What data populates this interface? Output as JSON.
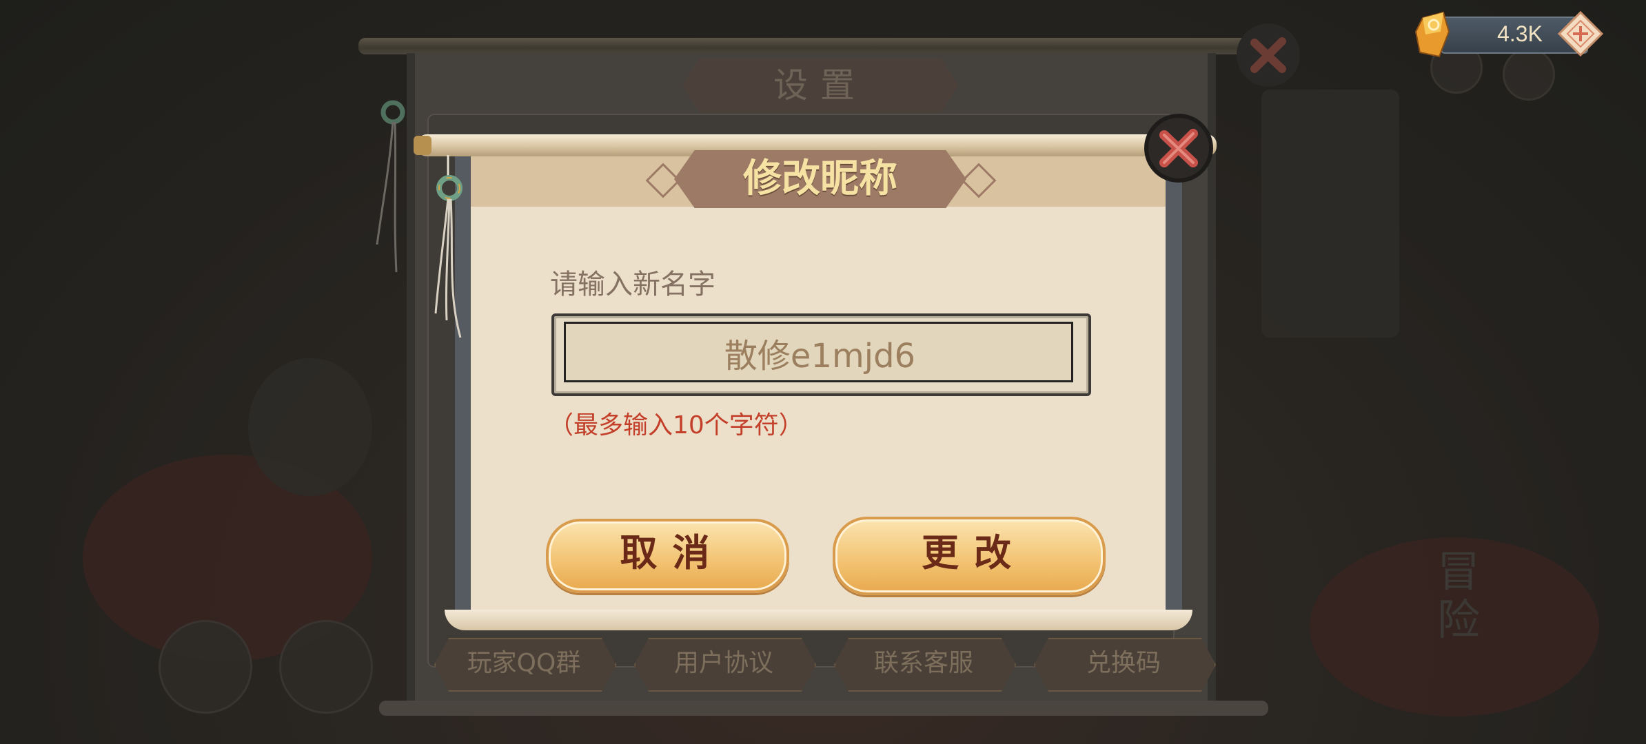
{
  "currency": {
    "amount": "4.3K",
    "icon": "gold-crystal-icon",
    "add_icon": "plus-diamond-icon"
  },
  "settings_panel": {
    "title": "设置",
    "tabs": [
      {
        "label": "玩家QQ群"
      },
      {
        "label": "用户协议"
      },
      {
        "label": "联系客服"
      },
      {
        "label": "兑换码"
      }
    ]
  },
  "side_buttons": {
    "adventure": "冒险"
  },
  "dialog": {
    "title": "修改昵称",
    "prompt": "请输入新名字",
    "name_value": "散修e1mjd6",
    "limit_hint": "（最多输入10个字符）",
    "cancel_label": "取消",
    "confirm_label": "更改"
  },
  "colors": {
    "title_text": "#f6e3a4",
    "button_text": "#6a2a17",
    "hint_text": "#c33f2a",
    "paper": "#ece0ca"
  }
}
